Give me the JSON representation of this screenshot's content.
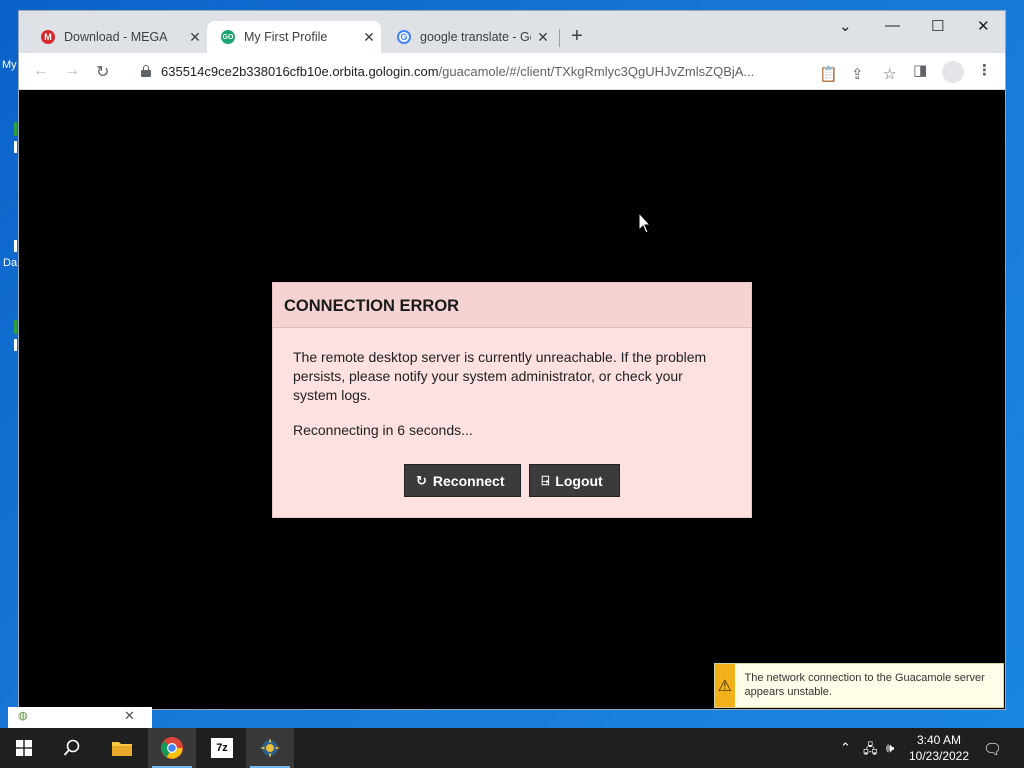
{
  "desktop": {
    "fragments": [
      "My",
      "Da"
    ]
  },
  "browser": {
    "tabs": [
      {
        "title": "Download - MEGA",
        "icon": "mega-icon",
        "active": false
      },
      {
        "title": "My First Profile",
        "icon": "gologin-icon",
        "active": true
      },
      {
        "title": "google translate - Go",
        "icon": "google-icon",
        "active": false
      }
    ],
    "address": {
      "domain": "635514c9ce2b338016cfb10e.orbita.gologin.com",
      "path": "/guacamole/#/client/TXkgRmlyc3QgUHJvZmlsZQBjA..."
    }
  },
  "dialog": {
    "title": "CONNECTION ERROR",
    "message": "The remote desktop server is currently unreachable. If the problem persists, please notify your system administrator, or check your system logs.",
    "countdown": "Reconnecting in 6 seconds...",
    "reconnect_label": "Reconnect",
    "logout_label": "Logout"
  },
  "notification": {
    "text": "The network connection to the Guacamole server appears unstable."
  },
  "taskbar": {
    "time": "3:40 AM",
    "date": "10/23/2022",
    "app_7z_label": "7z"
  },
  "colors": {
    "dialog_bg": "#fde0e0",
    "button_bg": "#3b3b3b",
    "warning": "#f2b11b"
  }
}
